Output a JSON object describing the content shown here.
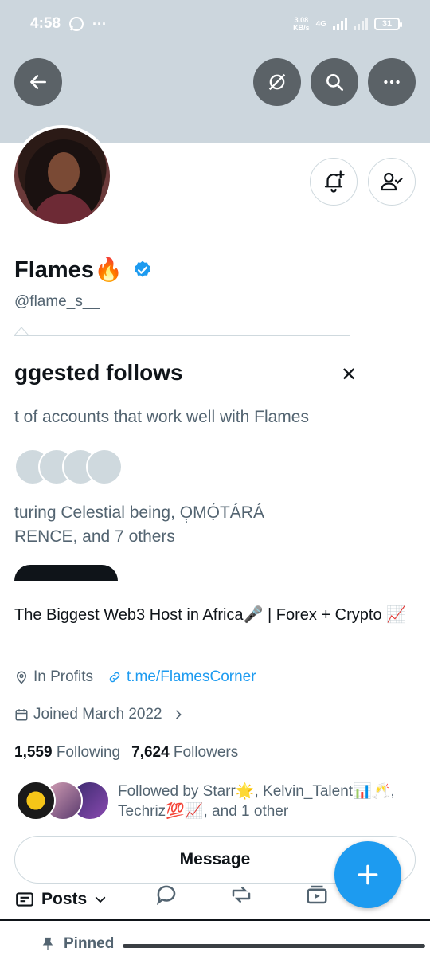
{
  "status_bar": {
    "time": "4:58",
    "net_speed_value": "3.08",
    "net_speed_unit": "KB/s",
    "network": "4G",
    "battery": "31"
  },
  "profile": {
    "name": "Flames🔥",
    "handle": "@flame_s__",
    "bio": "The Biggest Web3 Host in Africa🎤 | Forex + Crypto 📈",
    "location": "In Profits",
    "link": "t.me/FlamesCorner",
    "joined": "Joined March 2022",
    "following_count": "1,559",
    "following_label": "Following",
    "followers_count": "7,624",
    "followers_label": "Followers",
    "followed_by": "Followed by Starr🌟, Kelvin_Talent📊🥂, Techriz💯📈, and 1 other",
    "message_label": "Message"
  },
  "suggested": {
    "title": "ggested follows",
    "subtitle": "t of accounts that work well with Flames",
    "featuring": "turing Celestial being, Ọ̣MỌ́TÁRÁ\nRENCE, and 7 others"
  },
  "tabs": {
    "posts_label": "Posts"
  },
  "pinned": {
    "label": "Pinned"
  },
  "colors": {
    "accent": "#1d9bf0",
    "banner": "#ccd6dd",
    "text": "#0f1419",
    "muted": "#536471"
  }
}
